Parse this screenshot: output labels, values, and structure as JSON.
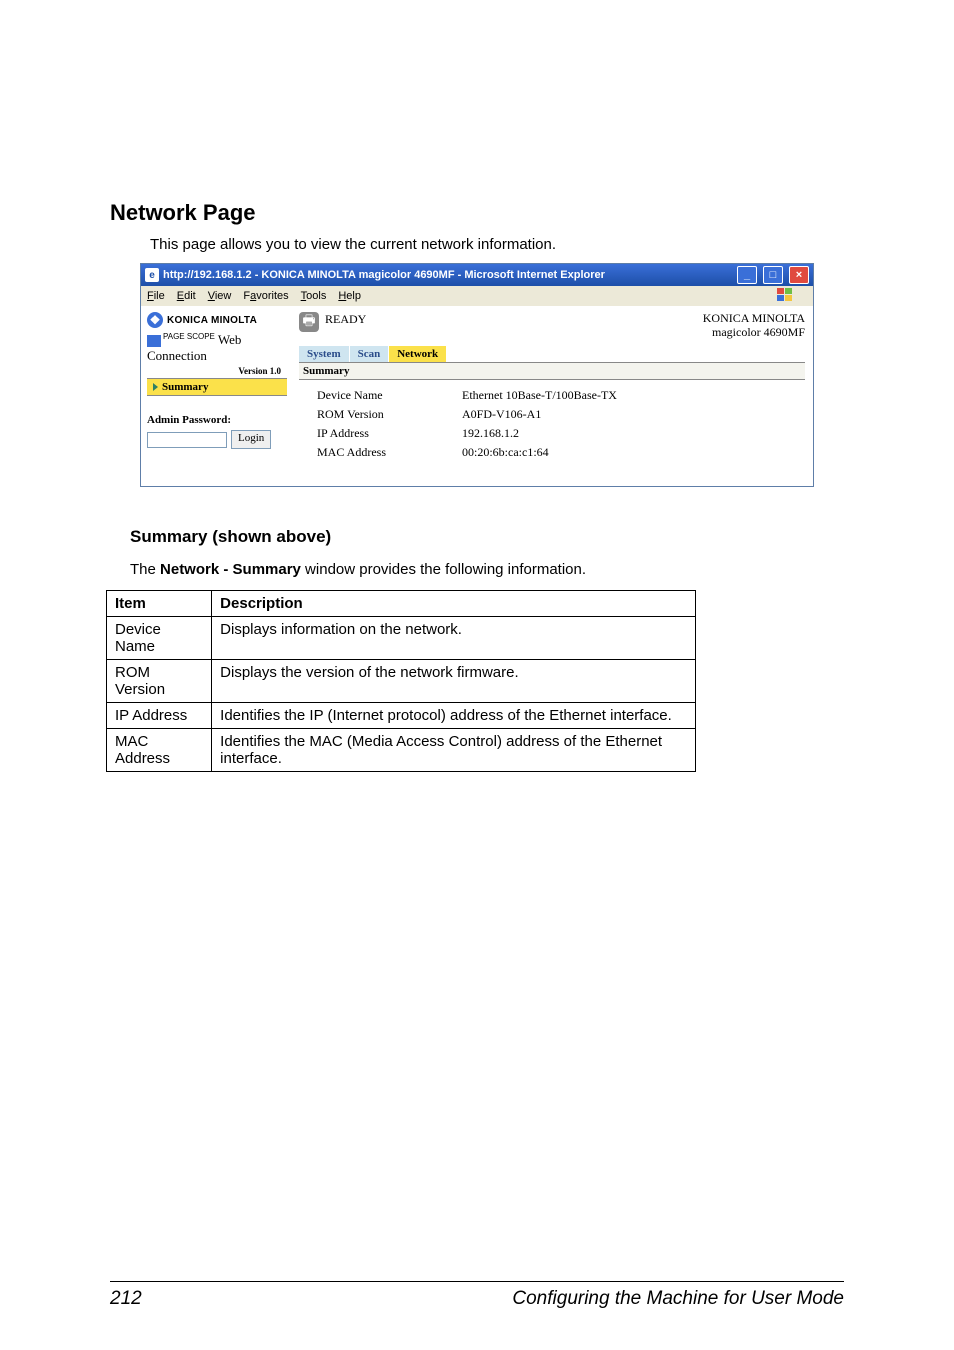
{
  "heading": "Network Page",
  "intro": "This page allows you to view the current network information.",
  "browser": {
    "title": "http://192.168.1.2 - KONICA MINOLTA magicolor 4690MF - Microsoft Internet Explorer",
    "min": "_",
    "max": "□",
    "close": "×",
    "menus": {
      "file": "File",
      "edit": "Edit",
      "view": "View",
      "favorites": "Favorites",
      "tools": "Tools",
      "help": "Help"
    }
  },
  "leftpane": {
    "brand": "KONICA MINOLTA",
    "pagescope_small": "PAGE SCOPE",
    "pagescope_main": "Web Connection",
    "version": "Version 1.0",
    "summary_link": "Summary",
    "admin_label": "Admin Password:",
    "login_button": "Login"
  },
  "rightpane": {
    "status": "READY",
    "model_line1": "KONICA MINOLTA",
    "model_line2": "magicolor 4690MF",
    "tabs": {
      "system": "System",
      "scan": "Scan",
      "network": "Network"
    },
    "section": "Summary",
    "rows": [
      {
        "label": "Device Name",
        "value": "Ethernet 10Base-T/100Base-TX"
      },
      {
        "label": "ROM Version",
        "value": "A0FD-V106-A1"
      },
      {
        "label": "IP Address",
        "value": "192.168.1.2"
      },
      {
        "label": "MAC Address",
        "value": "00:20:6b:ca:c1:64"
      }
    ]
  },
  "subsection": {
    "title": "Summary (shown above)",
    "intro_pre": "The ",
    "intro_bold": "Network - Summary",
    "intro_post": " window provides the following information.",
    "head_item": "Item",
    "head_desc": "Description",
    "rows": [
      {
        "item": "Device Name",
        "desc": "Displays information on the network."
      },
      {
        "item": "ROM Version",
        "desc": "Displays the version of the network firmware."
      },
      {
        "item": "IP Address",
        "desc": "Identifies the IP (Internet protocol) address of the Ethernet interface."
      },
      {
        "item": "MAC Address",
        "desc": "Identifies the MAC (Media Access Control) address of the Ethernet interface."
      }
    ]
  },
  "footer": {
    "page": "212",
    "label": "Configuring the Machine for User Mode"
  }
}
